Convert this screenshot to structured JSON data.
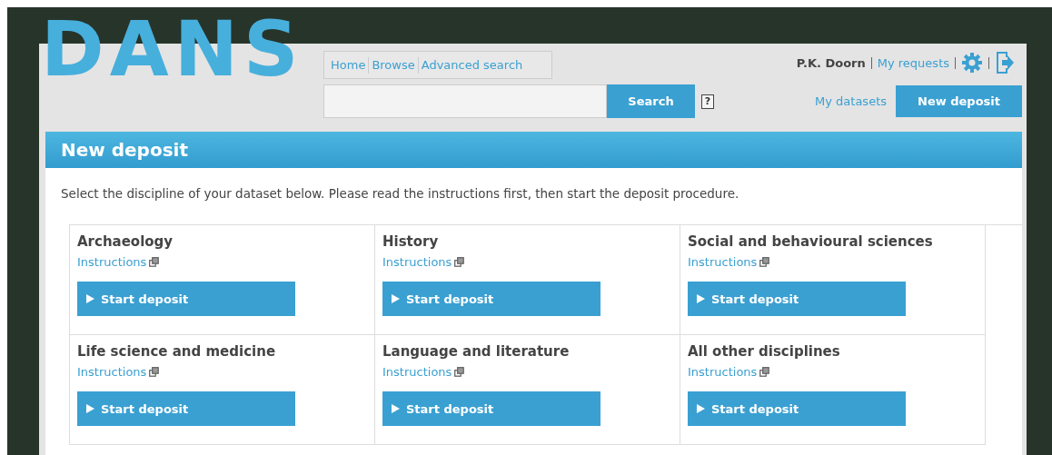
{
  "logo": "DANS",
  "nav": [
    {
      "label": "Home"
    },
    {
      "label": "Browse"
    },
    {
      "label": "Advanced search"
    }
  ],
  "search": {
    "button": "Search",
    "help": "?"
  },
  "user": {
    "name": "P.K. Doorn",
    "links": [
      "My requests"
    ]
  },
  "actions": {
    "link": "My datasets",
    "button": "New deposit"
  },
  "title": "New deposit",
  "intro": "Select the discipline of your dataset below. Please read the instructions first, then start the deposit procedure.",
  "disciplines": [
    {
      "name": "Archaeology",
      "link": "Instructions",
      "button": "Start deposit"
    },
    {
      "name": "History",
      "link": "Instructions",
      "button": "Start deposit"
    },
    {
      "name": "Social and behavioural sciences",
      "link": "Instructions",
      "button": "Start deposit"
    },
    {
      "name": "Life science and medicine",
      "link": "Instructions",
      "button": "Start deposit"
    },
    {
      "name": "Language and literature",
      "link": "Instructions",
      "button": "Start deposit"
    },
    {
      "name": "All other disciplines",
      "link": "Instructions",
      "button": "Start deposit"
    }
  ]
}
